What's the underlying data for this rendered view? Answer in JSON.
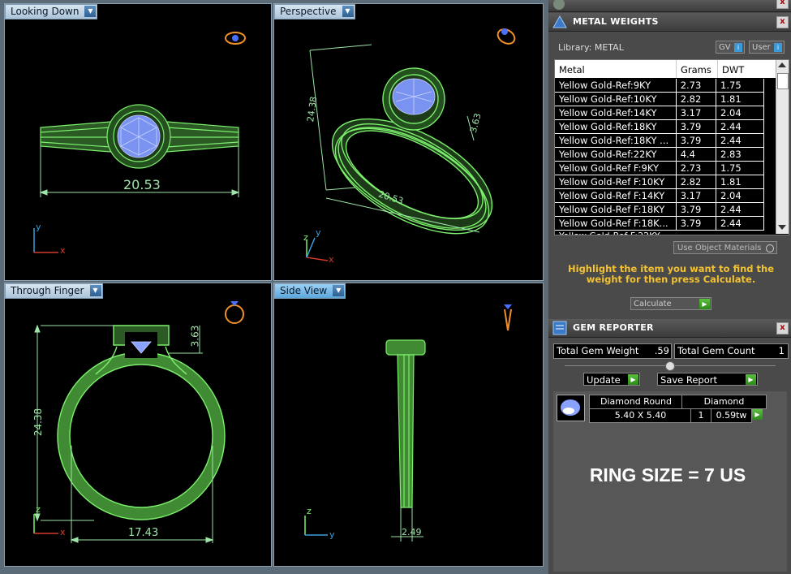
{
  "viewports": [
    {
      "label": "Looking Down",
      "active": false
    },
    {
      "label": "Perspective",
      "active": false
    },
    {
      "label": "Through Finger",
      "active": false
    },
    {
      "label": "Side View",
      "active": true
    }
  ],
  "dimensions": {
    "top_width": "20.53",
    "persp_a": "24.38",
    "persp_b": "3.63",
    "persp_c": "20.53",
    "height": "24.38",
    "head": "3.63",
    "inner_width": "17.43",
    "shank": "2.49"
  },
  "axes": {
    "x": "x",
    "y": "y",
    "z": "z"
  },
  "metal_weights": {
    "title": "METAL WEIGHTS",
    "library_label": "Library: METAL",
    "gv_label": "GV",
    "user_label": "User",
    "columns": [
      "Metal",
      "Grams",
      "DWT"
    ],
    "rows": [
      [
        "Yellow Gold-Ref:9KY",
        "2.73",
        "1.75"
      ],
      [
        "Yellow Gold-Ref:10KY",
        "2.82",
        "1.81"
      ],
      [
        "Yellow Gold-Ref:14KY",
        "3.17",
        "2.04"
      ],
      [
        "Yellow Gold-Ref:18KY",
        "3.79",
        "2.44"
      ],
      [
        "Yellow Gold-Ref:18KY ...",
        "3.79",
        "2.44"
      ],
      [
        "Yellow Gold-Ref:22KY",
        "4.4",
        "2.83"
      ],
      [
        "Yellow Gold-Ref F:9KY",
        "2.73",
        "1.75"
      ],
      [
        "Yellow Gold-Ref F:10KY",
        "2.82",
        "1.81"
      ],
      [
        "Yellow Gold-Ref F:14KY",
        "3.17",
        "2.04"
      ],
      [
        "Yellow Gold-Ref F:18KY",
        "3.79",
        "2.44"
      ],
      [
        "Yellow Gold-Ref F:18K...",
        "3.79",
        "2.44"
      ]
    ],
    "use_object_materials": "Use Object Materials",
    "hint": "Highlight the item you want to find the weight for then press Calculate.",
    "calculate_label": "Calculate"
  },
  "gem_reporter": {
    "title": "GEM REPORTER",
    "total_weight_label": "Total Gem Weight",
    "total_weight_value": ".59",
    "total_count_label": "Total Gem Count",
    "total_count_value": "1",
    "update_label": "Update",
    "save_report_label": "Save Report",
    "gem_name": "Diamond Round",
    "gem_type": "Diamond",
    "gem_size": "5.40 X 5.40",
    "gem_qty": "1",
    "gem_tw": "0.59tw"
  },
  "ring_size": "RING SIZE = 7 US",
  "colors": {
    "ring": "#7cf06c",
    "gem": "#8aa2ff",
    "dim": "#9ee4a8",
    "axis_x": "#d43a2a",
    "axis_y": "#3aa0d8",
    "panel": "#4a4a4a",
    "hint": "#f2c232"
  }
}
